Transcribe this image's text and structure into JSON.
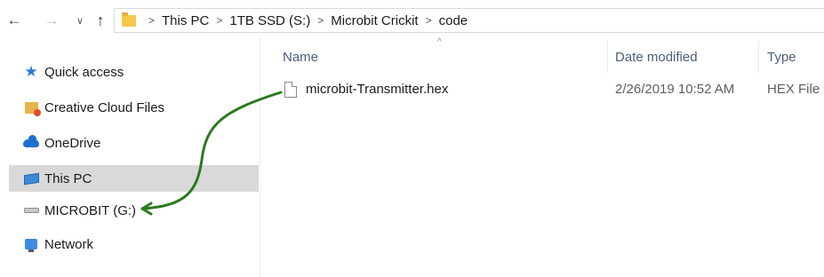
{
  "nav": {
    "back_icon": "arrow-left-icon",
    "forward_icon": "arrow-right-icon",
    "recent_icon": "chevron-down-icon",
    "up_icon": "arrow-up-icon",
    "back_glyph": "←",
    "forward_glyph": "→",
    "recent_glyph": "∨",
    "up_glyph": "↑"
  },
  "address_bar": {
    "separator": ">",
    "crumbs": [
      "This PC",
      "1TB SSD (S:)",
      "Microbit Crickit",
      "code"
    ]
  },
  "sidebar": {
    "items": [
      {
        "label": "Quick access",
        "icon": "star-icon",
        "selected": false
      },
      {
        "label": "Creative Cloud Files",
        "icon": "creative-cloud-folder-icon",
        "selected": false
      },
      {
        "label": "OneDrive",
        "icon": "cloud-icon",
        "selected": false
      },
      {
        "label": "This PC",
        "icon": "computer-icon",
        "selected": true
      },
      {
        "label": "MICROBIT (G:)",
        "icon": "drive-icon",
        "selected": false
      },
      {
        "label": "Network",
        "icon": "network-icon",
        "selected": false
      }
    ]
  },
  "file_list": {
    "columns": {
      "name": "Name",
      "date": "Date modified",
      "type": "Type"
    },
    "sort_caret": "^",
    "rows": [
      {
        "name": "microbit-Transmitter.hex",
        "date": "2/26/2019 10:52 AM",
        "type": "HEX File"
      }
    ]
  },
  "annotation": {
    "color": "#2a7a1e",
    "description_icon": "green-arrow-icon"
  },
  "colors": {
    "selected_bg": "#d9d9d9",
    "header_text": "#4c607a",
    "accent_blue": "#2b79d6"
  }
}
